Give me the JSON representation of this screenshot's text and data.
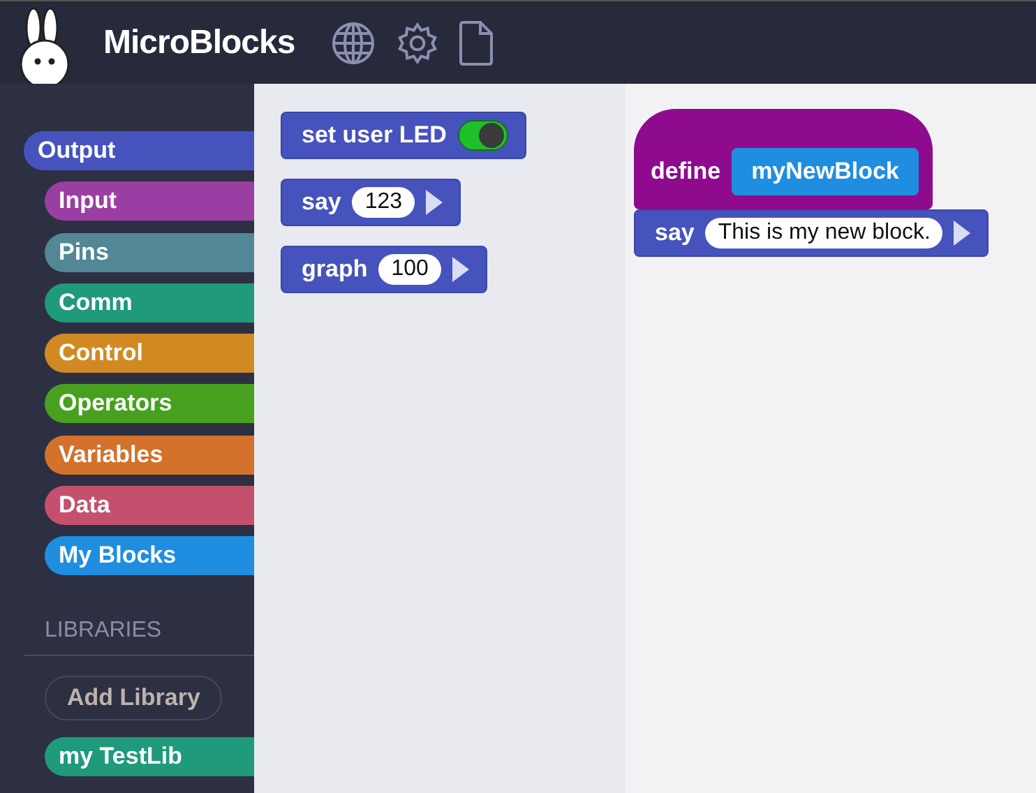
{
  "app": {
    "title": "MicroBlocks"
  },
  "categories": [
    {
      "label": "Output",
      "color": "#4653bd",
      "selected": true
    },
    {
      "label": "Input",
      "color": "#9b3ea3",
      "selected": false
    },
    {
      "label": "Pins",
      "color": "#528796",
      "selected": false
    },
    {
      "label": "Comm",
      "color": "#1f9a7a",
      "selected": false
    },
    {
      "label": "Control",
      "color": "#d18a22",
      "selected": false
    },
    {
      "label": "Operators",
      "color": "#47a11f",
      "selected": false
    },
    {
      "label": "Variables",
      "color": "#d4712a",
      "selected": false
    },
    {
      "label": "Data",
      "color": "#c4506e",
      "selected": false
    },
    {
      "label": "My Blocks",
      "color": "#1f8ee0",
      "selected": false
    }
  ],
  "libraries": {
    "heading": "LIBRARIES",
    "add_button": "Add Library",
    "items": [
      {
        "label": "my TestLib",
        "color": "#1f9a7a",
        "selected": false
      }
    ]
  },
  "palette": [
    {
      "kind": "toggle",
      "label": "set user LED",
      "on": true
    },
    {
      "kind": "input",
      "label": "say",
      "value": "123"
    },
    {
      "kind": "input",
      "label": "graph",
      "value": "100"
    }
  ],
  "script": {
    "hat_label": "define",
    "block_name": "myNewBlock",
    "body": [
      {
        "kind": "input",
        "label": "say",
        "value": "This is my new block."
      }
    ]
  }
}
